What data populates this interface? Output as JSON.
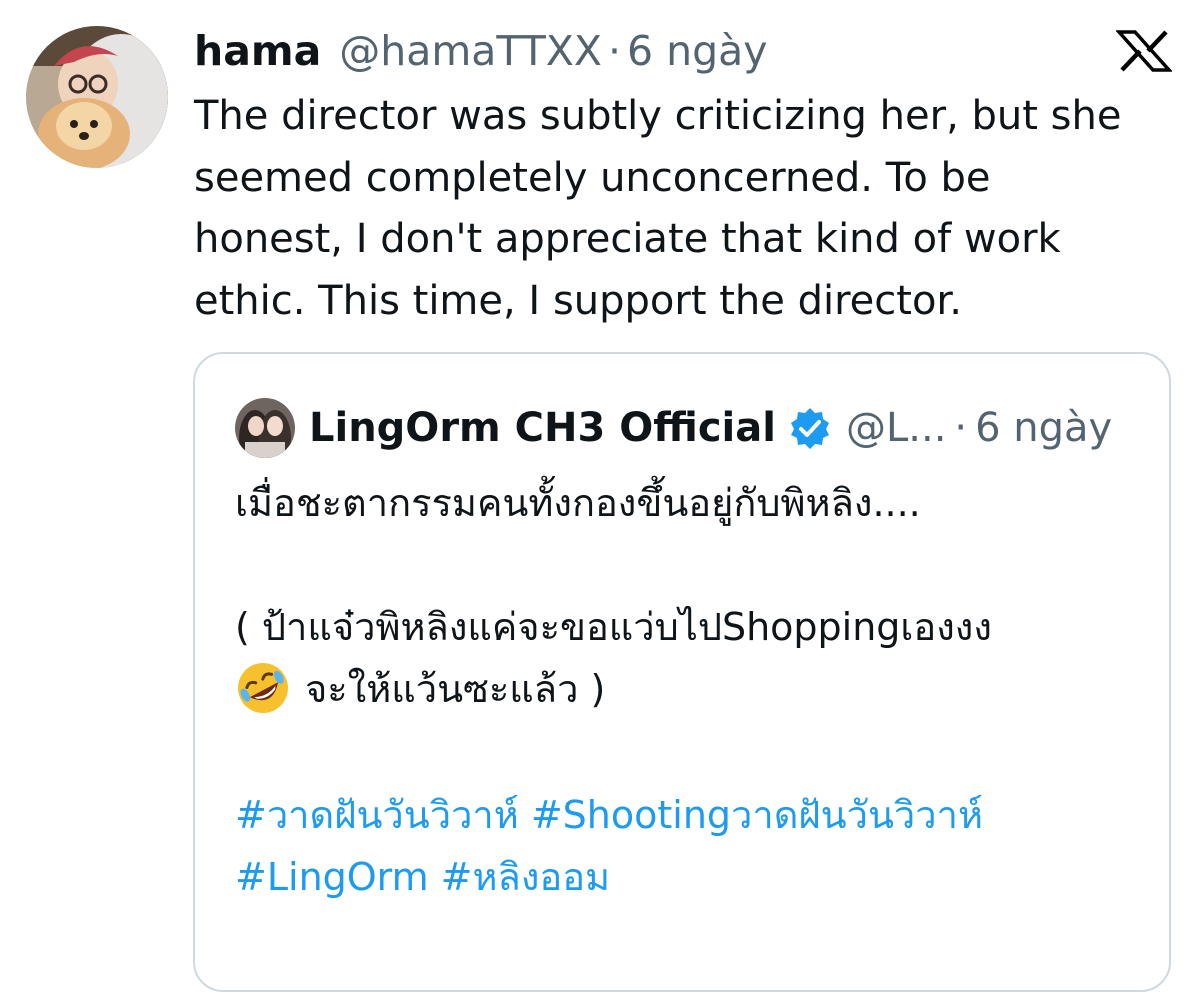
{
  "tweet": {
    "author_name": "hama",
    "handle": "@hamaTTXX",
    "separator": "·",
    "time": "6 ngày",
    "avatar_icon": "avatar-person-with-dog",
    "platform_icon": "x-logo-icon",
    "text_lines": [
      "The director was subtly criticizing her, but she",
      "seemed completely unconcerned. To be",
      "honest, I don't appreciate that kind of work",
      "ethic. This time, I support the director."
    ]
  },
  "quoted_tweet": {
    "author_name": "LingOrm CH3 Official",
    "handle": "@L...",
    "separator": "·",
    "time": "6 ngày",
    "verified_icon": "verified-badge-icon",
    "verified_color": "#1d9bf0",
    "line1": "เมื่อชะตากรรมคนทั้งกองขึ้นอยู่กับพิหลิง....",
    "line2": "( ป้าแจ๋วพิหลิงแค่จะขอแว่บไปShoppingเองงง",
    "emoji_icon": "rolling-on-floor-laughing-emoji",
    "line3": "จะให้แว้นซะแล้ว )",
    "hashtags_row1": [
      "#วาดฝันวันวิวาห์",
      "#Shootingวาดฝันวันวิวาห์"
    ],
    "hashtags_row2": [
      "#LingOrm",
      "#หลิงออม"
    ]
  },
  "colors": {
    "text": "#0f1419",
    "muted": "#536471",
    "link": "#1d9bf0",
    "border": "#cfd9de"
  }
}
